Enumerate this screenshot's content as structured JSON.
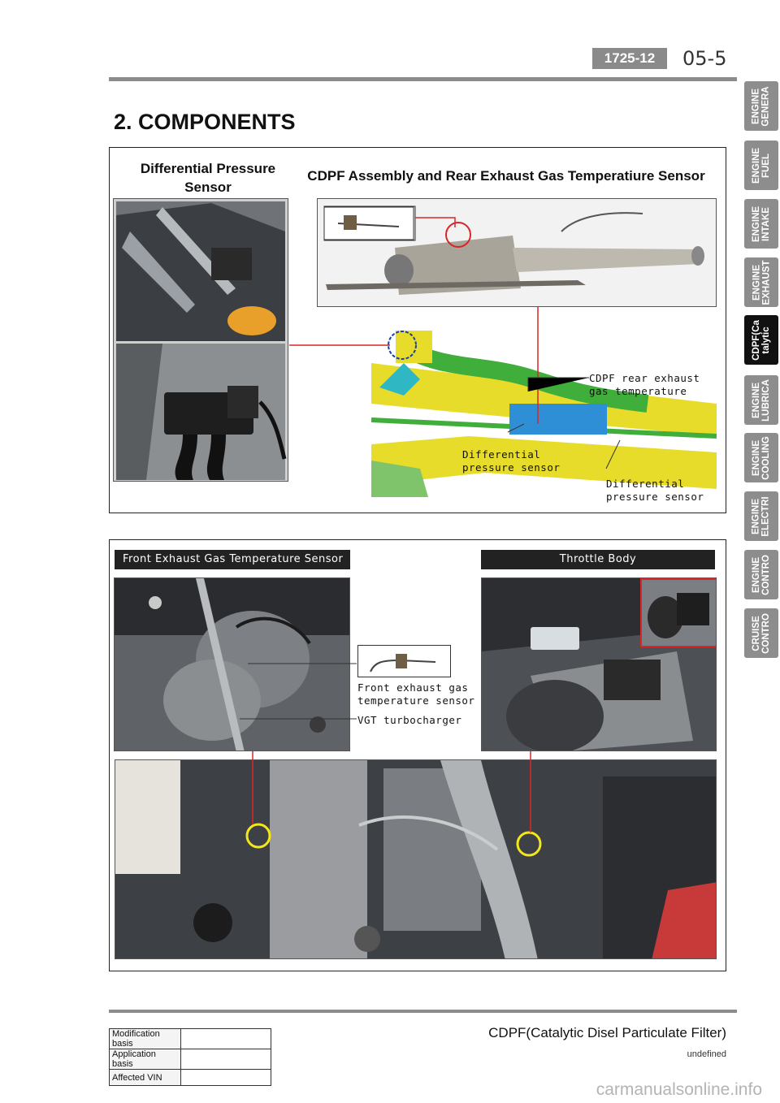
{
  "header": {
    "page_code": "1725-12",
    "page_number": "05-5",
    "section_title": "2. COMPONENTS"
  },
  "tabs": [
    {
      "label": "ENGINE\nGENERA",
      "active": false
    },
    {
      "label": "ENGINE\nFUEL",
      "active": false
    },
    {
      "label": "ENGINE\nINTAKE",
      "active": false
    },
    {
      "label": "ENGINE\nEXHAUST",
      "active": false
    },
    {
      "label": "CDPF(Ca\ntalytic",
      "active": true
    },
    {
      "label": "ENGINE\nLUBRICA",
      "active": false
    },
    {
      "label": "ENGINE\nCOOLING",
      "active": false
    },
    {
      "label": "ENGINE\nELECTRI",
      "active": false
    },
    {
      "label": "ENGINE\nCONTRO",
      "active": false
    },
    {
      "label": "CRUISE\nCONTRO",
      "active": false
    }
  ],
  "panel1": {
    "left_caption": "Differential Pressure\nSensor",
    "right_caption": "CDPF Assembly and Rear Exhaust Gas Temperatiure Sensor",
    "callouts": {
      "rear_temp": "CDPF rear exhaust\ngas temperature",
      "diff_sensor_1": "Differential\npressure sensor",
      "diff_sensor_2": "Differential\npressure sensor"
    }
  },
  "panel2": {
    "left_label": "Front Exhaust Gas Temperature Sensor",
    "right_label": "Throttle Body",
    "callouts": {
      "front_temp": "Front exhaust gas\ntemperature sensor",
      "vgt": "VGT turbocharger"
    }
  },
  "footer": {
    "title": "CDPF(Catalytic Disel Particulate Filter)",
    "subtitle": "undefined",
    "table": [
      {
        "label": "Modification basis",
        "value": ""
      },
      {
        "label": "Application basis",
        "value": ""
      },
      {
        "label": "Affected VIN",
        "value": ""
      }
    ],
    "watermark": "carmanualsonline.info"
  },
  "colors": {
    "tab_gray": "#8d8d8d",
    "tab_active": "#111111",
    "callout_red": "#d9262a",
    "highlight_yellow": "#f3e61b",
    "chassis_yellow": "#e8dc2a",
    "pipe_green": "#3fae3a",
    "cdpf_blue": "#2f8fd6"
  }
}
